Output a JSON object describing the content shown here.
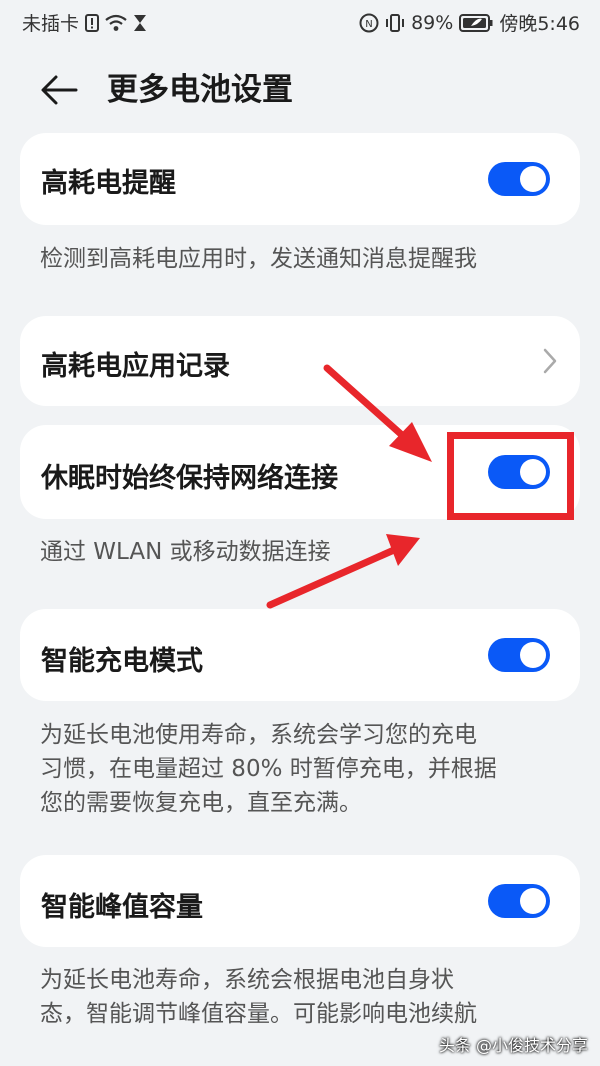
{
  "status_bar": {
    "carrier": "未插卡",
    "battery": "89%",
    "time": "傍晚5:46"
  },
  "header": {
    "title": "更多电池设置"
  },
  "settings": [
    {
      "label": "高耗电提醒",
      "toggle_on": true,
      "description": "检测到高耗电应用时，发送通知消息提醒我"
    },
    {
      "label": "高耗电应用记录"
    },
    {
      "label": "休眠时始终保持网络连接",
      "toggle_on": true,
      "description": "通过 WLAN 或移动数据连接"
    },
    {
      "label": "智能充电模式",
      "toggle_on": true,
      "description": [
        "为延长电池使用寿命，系统会学习您的充电",
        "习惯，在电量超过 80% 时暂停充电，并根据",
        "您的需要恢复充电，直至充满。"
      ]
    },
    {
      "label": "智能峰值容量",
      "toggle_on": true,
      "description": [
        "为延长电池寿命，系统会根据电池自身状",
        "态，智能调节峰值容量。可能影响电池续航"
      ]
    }
  ],
  "watermark": "头条 @小俊技术分享",
  "colors": {
    "toggle_on": "#0a59f7",
    "annotation": "#e8262b",
    "background": "#f1f3f5"
  }
}
